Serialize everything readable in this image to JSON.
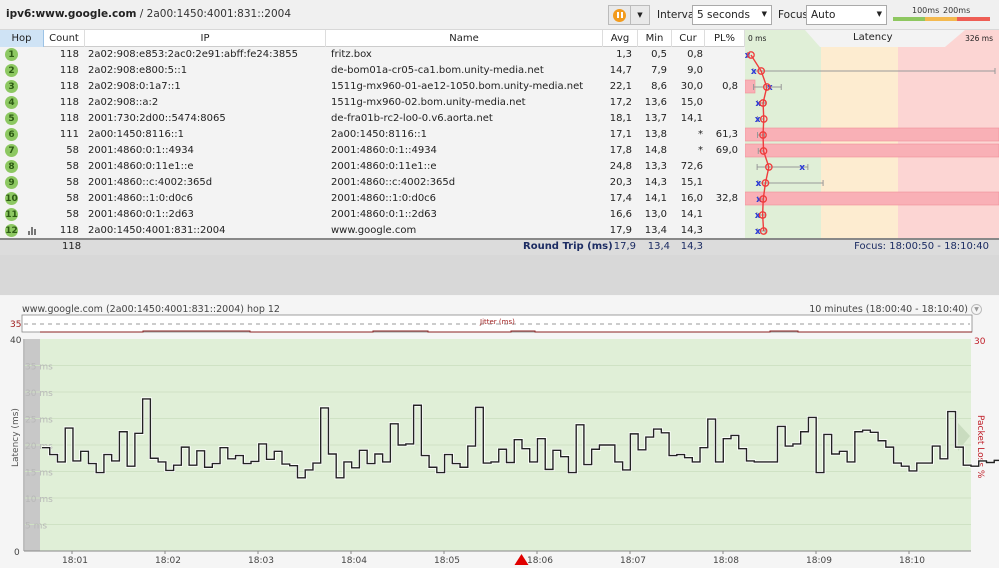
{
  "window": {
    "target_prefix": "ipv6:www.google.com",
    "target_suffix": " / 2a00:1450:4001:831::2004"
  },
  "toolbar": {
    "pause_icon": "pause-icon",
    "dropdown_icon": "chevron-down-icon",
    "interval_label": "Interval",
    "interval_value": "5 seconds",
    "focus_label": "Focus",
    "focus_value": "Auto",
    "legend": {
      "t100": "100ms",
      "t200": "200ms",
      "colors": {
        "good": "#8ec760",
        "warn": "#f4b94f",
        "bad": "#ee5e55"
      }
    }
  },
  "table": {
    "columns": [
      "Hop",
      "Count",
      "IP",
      "Name",
      "Avg",
      "Min",
      "Cur",
      "PL%"
    ],
    "latency_header": {
      "min": "0 ms",
      "title": "Latency",
      "max": "326 ms"
    },
    "rows": [
      {
        "hop": "1",
        "count": "118",
        "ip": "2a02:908:e853:2ac0:2e91:abff:fe24:3855",
        "name": "fritz.box",
        "avg": "1,3",
        "min": "0,5",
        "cur": "0,8",
        "pl": ""
      },
      {
        "hop": "2",
        "count": "118",
        "ip": "2a02:908:e800:5::1",
        "name": "de-bom01a-cr05-ca1.bom.unity-media.net",
        "avg": "14,7",
        "min": "7,9",
        "cur": "9,0",
        "pl": ""
      },
      {
        "hop": "3",
        "count": "118",
        "ip": "2a02:908:0:1a7::1",
        "name": "1511g-mx960-01-ae12-1050.bom.unity-media.net",
        "avg": "22,1",
        "min": "8,6",
        "cur": "30,0",
        "pl": "0,8"
      },
      {
        "hop": "4",
        "count": "118",
        "ip": "2a02:908::a:2",
        "name": "1511g-mx960-02.bom.unity-media.net",
        "avg": "17,2",
        "min": "13,6",
        "cur": "15,0",
        "pl": ""
      },
      {
        "hop": "5",
        "count": "118",
        "ip": "2001:730:2d00::5474:8065",
        "name": "de-fra01b-rc2-lo0-0.v6.aorta.net",
        "avg": "18,1",
        "min": "13,7",
        "cur": "14,1",
        "pl": ""
      },
      {
        "hop": "6",
        "count": "111",
        "ip": "2a00:1450:8116::1",
        "name": "2a00:1450:8116::1",
        "avg": "17,1",
        "min": "13,8",
        "cur": "*",
        "pl": "61,3"
      },
      {
        "hop": "7",
        "count": "58",
        "ip": "2001:4860:0:1::4934",
        "name": "2001:4860:0:1::4934",
        "avg": "17,8",
        "min": "14,8",
        "cur": "*",
        "pl": "69,0"
      },
      {
        "hop": "8",
        "count": "58",
        "ip": "2001:4860:0:11e1::e",
        "name": "2001:4860:0:11e1::e",
        "avg": "24,8",
        "min": "13,3",
        "cur": "72,6",
        "pl": ""
      },
      {
        "hop": "9",
        "count": "58",
        "ip": "2001:4860::c:4002:365d",
        "name": "2001:4860::c:4002:365d",
        "avg": "20,3",
        "min": "14,3",
        "cur": "15,1",
        "pl": ""
      },
      {
        "hop": "10",
        "count": "58",
        "ip": "2001:4860::1:0:d0c6",
        "name": "2001:4860::1:0:d0c6",
        "avg": "17,4",
        "min": "14,1",
        "cur": "16,0",
        "pl": "32,8"
      },
      {
        "hop": "11",
        "count": "58",
        "ip": "2001:4860:0:1::2d63",
        "name": "2001:4860:0:1::2d63",
        "avg": "16,6",
        "min": "13,0",
        "cur": "14,1",
        "pl": ""
      },
      {
        "hop": "12",
        "count": "118",
        "ip": "2a00:1450:4001:831::2004",
        "name": "www.google.com",
        "avg": "17,9",
        "min": "13,4",
        "cur": "14,3",
        "pl": "",
        "graph_icon": "bar-chart-icon"
      }
    ],
    "latency_bars": [
      {
        "avg": 1.3,
        "min": 0.5,
        "max": 3,
        "cur": 0.8,
        "pl": 0
      },
      {
        "avg": 14.7,
        "min": 7.9,
        "max": 326,
        "cur": 9.0,
        "pl": 0
      },
      {
        "avg": 22.1,
        "min": 8.6,
        "max": 45,
        "cur": 30.0,
        "pl": 0.8
      },
      {
        "avg": 17.2,
        "min": 13.6,
        "max": 24,
        "cur": 15.0,
        "pl": 0
      },
      {
        "avg": 18.1,
        "min": 13.7,
        "max": 22,
        "cur": 14.1,
        "pl": 0
      },
      {
        "avg": 17.1,
        "min": 13.8,
        "max": 23,
        "cur": null,
        "pl": 61.3
      },
      {
        "avg": 17.8,
        "min": 14.8,
        "max": 22,
        "cur": null,
        "pl": 69.0
      },
      {
        "avg": 24.8,
        "min": 13.3,
        "max": 80,
        "cur": 72.6,
        "pl": 0
      },
      {
        "avg": 20.3,
        "min": 14.3,
        "max": 100,
        "cur": 15.1,
        "pl": 0
      },
      {
        "avg": 17.4,
        "min": 14.1,
        "max": 22,
        "cur": 16.0,
        "pl": 32.8
      },
      {
        "avg": 16.6,
        "min": 13.0,
        "max": 24,
        "cur": 14.1,
        "pl": 0
      },
      {
        "avg": 17.9,
        "min": 13.4,
        "max": 24,
        "cur": 14.3,
        "pl": 0
      }
    ],
    "footer": {
      "count": "118",
      "label": "Round Trip (ms)",
      "avg": "17,9",
      "min": "13,4",
      "cur": "14,3",
      "focus": "Focus: 18:00:50 - 18:10:40"
    }
  },
  "splitter": {
    "icon": "drag-handle-icon"
  },
  "graph": {
    "title": "www.google.com (2a00:1450:4001:831::2004) hop 12",
    "range": "10 minutes (18:00:40 - 18:10:40)",
    "range_icon": "chevron-down-icon",
    "jitter_label": "Jitter (ms)",
    "jitter_max": "35",
    "left_max": "40",
    "left_min": "0",
    "right_max": "30",
    "ylabel": "Latency (ms)",
    "y2label": "Packet Loss %",
    "marker_icon": "current-time-marker-icon"
  },
  "chart_data": {
    "type": "line",
    "title": "www.google.com (2a00:1450:4001:831::2004) hop 12",
    "xlabel": "",
    "ylabel": "Latency (ms)",
    "y2label": "Packet Loss %",
    "ylim": [
      0,
      40
    ],
    "y2lim": [
      0,
      30
    ],
    "grid": true,
    "ytick_labels": [
      "5 ms",
      "10 ms",
      "15 ms",
      "20 ms",
      "25 ms",
      "30 ms",
      "35 ms"
    ],
    "ytick_values": [
      5,
      10,
      15,
      20,
      25,
      30,
      35
    ],
    "xtick_labels": [
      "18:01",
      "18:02",
      "18:03",
      "18:04",
      "18:05",
      "18:06",
      "18:07",
      "18:08",
      "18:09",
      "18:10"
    ],
    "x_range_seconds": [
      0,
      600
    ],
    "x_start": "18:00:40",
    "sample_interval_s": 5,
    "first_sample_s": 10,
    "series": [
      {
        "name": "Latency",
        "step": true,
        "values": [
          19.5,
          18.2,
          16.8,
          23.2,
          17.0,
          18.8,
          16.5,
          14.8,
          18.2,
          17.0,
          22.5,
          16.0,
          22.2,
          28.7,
          17.5,
          16.8,
          15.2,
          16.2,
          19.6,
          16.2,
          18.9,
          15.8,
          16.5,
          19.5,
          17.4,
          18.0,
          16.5,
          16.9,
          20.2,
          17.3,
          18.8,
          16.4,
          16.1,
          13.8,
          15.3,
          16.6,
          27.0,
          18.3,
          13.8,
          16.8,
          15.7,
          19.0,
          16.5,
          18.3,
          16.8,
          24.0,
          20.0,
          20.2,
          27.5,
          18.0,
          15.8,
          14.8,
          18.2,
          16.5,
          15.8,
          19.8,
          27.1,
          16.6,
          16.8,
          19.2,
          16.7,
          21.0,
          19.3,
          16.8,
          21.2,
          15.4,
          19.0,
          17.8,
          14.8,
          23.8,
          16.3,
          19.2,
          20.0,
          20.0,
          16.8,
          15.3,
          22.1,
          19.1,
          21.5,
          23.0,
          22.3,
          18.0,
          18.2,
          17.6,
          16.8,
          19.5,
          24.9,
          16.8,
          21.2,
          21.8,
          19.3,
          17.0,
          16.8,
          16.8,
          16.8,
          23.5,
          19.8,
          20.2,
          22.5,
          25.2,
          14.8,
          22.0,
          18.3,
          18.8,
          16.8,
          22.5,
          22.8,
          22.4,
          20.8,
          19.6,
          16.6,
          16.0,
          15.1,
          16.6,
          16.6,
          19.8,
          17.4,
          26.3,
          19.6,
          16.2,
          16.0,
          17.0,
          16.7,
          17.1,
          19.5,
          17.2,
          15.2,
          16.0
        ]
      },
      {
        "name": "Jitter",
        "axis": "jitter",
        "step": true,
        "values": []
      }
    ],
    "current_time_marker": "18:05:50"
  }
}
